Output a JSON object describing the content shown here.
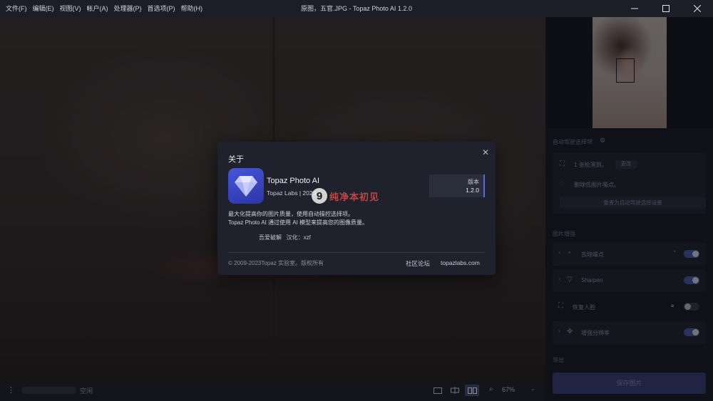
{
  "menu": [
    "文件(F)",
    "编辑(E)",
    "视图(V)",
    "帐户(A)",
    "处理器(P)",
    "首选项(P)",
    "帮助(H)"
  ],
  "window": {
    "title": "原图，五官.JPG - Topaz Photo AI 1.2.0",
    "minimize_icon": "minimize-icon",
    "maximize_icon": "maximize-icon",
    "close_icon": "close-icon"
  },
  "statusbar": {
    "status_text": "空闲",
    "zoom": "67%",
    "view_icons": [
      "single-view-icon",
      "split-view-icon",
      "side-by-side-view-icon"
    ]
  },
  "panel": {
    "autopilot_title": "自动驾驶选择项",
    "faces_row": "1 张检测到。",
    "faces_pill": "更改",
    "noise_row": "删除低图片噪点。",
    "reset_button": "重置为自动驾驶选择设置",
    "enhance_title": "图片增强",
    "modules": [
      {
        "label": "去除噪点",
        "on": true
      },
      {
        "label": "Sharpen",
        "on": true
      },
      {
        "label": "恢复人脸",
        "on": false
      },
      {
        "label": "增强分辨率",
        "on": true
      }
    ],
    "export_title": "导出",
    "save_button": "保存图片"
  },
  "about": {
    "title": "关于",
    "app_name": "Topaz Photo AI",
    "company": "Topaz Labs | 2023",
    "watermark_text": "纯净本初见",
    "version_label": "版本",
    "version_value": "1.2.0",
    "desc_line1": "最大化提高你的图片质量，使用自动操控选择项。",
    "desc_line2": "Topaz Photo AI 通过使用 AI 模型来提高您的图像质量。",
    "credit": "吾爱破解   汉化：xzf",
    "copyright": "© 2009-2023Topaz 实验室。版权所有",
    "forum_link": "社区论坛",
    "site_link": "topazlabs.com"
  }
}
